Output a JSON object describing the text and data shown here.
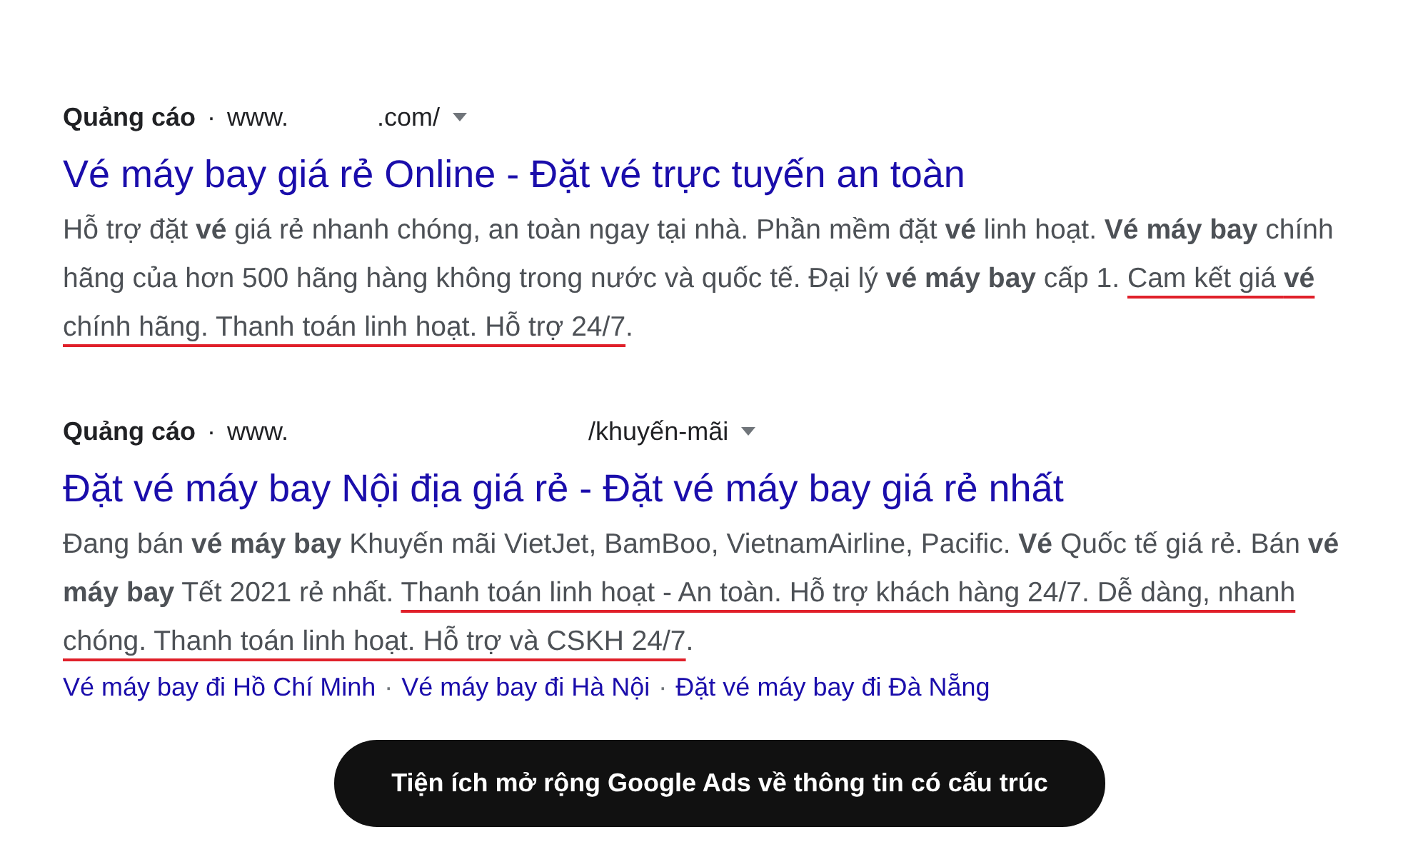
{
  "ads": [
    {
      "label": "Quảng cáo",
      "separator": "·",
      "url_parts": [
        "www.",
        ".com/"
      ],
      "title": "Vé máy bay giá rẻ Online - Đặt vé trực tuyến an toàn",
      "description": [
        {
          "text": "Hỗ trợ đặt **vé** giá rẻ nhanh chóng, an toàn ngay tại nhà. Phần mềm đặt **vé** linh hoạt. **Vé máy bay** chính hãng của hơn 500 hãng hàng không trong nước và quốc tế. Đại lý **vé máy bay** cấp 1. "
        },
        {
          "text": "Cam kết giá **vé** chính hãng. Thanh toán linh hoạt. Hỗ trợ 24/7",
          "underlined": true
        },
        {
          "text": "."
        }
      ]
    },
    {
      "label": "Quảng cáo",
      "separator": "·",
      "url_parts": [
        "www.",
        "/khuyến-mãi"
      ],
      "title": "Đặt vé máy bay Nội địa giá rẻ - Đặt vé máy bay giá rẻ nhất",
      "description": [
        {
          "text": "Đang bán **vé máy bay** Khuyến mãi VietJet, BamBoo, VietnamAirline, Pacific. **Vé** Quốc tế giá rẻ. Bán **vé máy bay** Tết 2021 rẻ nhất. "
        },
        {
          "text": "Thanh toán linh hoạt - An toàn. Hỗ trợ khách hàng 24/7. Dễ dàng, nhanh chóng. Thanh toán linh hoạt. Hỗ trợ và CSKH 24/7",
          "underlined": true
        },
        {
          "text": "."
        }
      ],
      "sitelinks": [
        "Vé máy bay đi Hồ Chí Minh",
        "Vé máy bay đi Hà Nội",
        "Đặt vé máy bay đi Đà Nẵng"
      ],
      "sitelink_separator": "·"
    }
  ],
  "caption": "Tiện ích mở rộng Google Ads về thông tin có cấu trúc"
}
